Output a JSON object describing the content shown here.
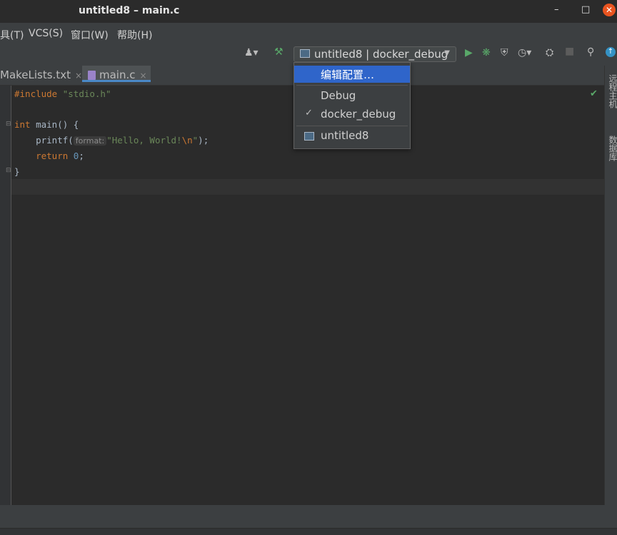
{
  "window": {
    "title": "untitled8 – main.c",
    "min": "–",
    "max": "□",
    "close": "✕"
  },
  "menu": [
    {
      "label": "具(T)"
    },
    {
      "label": "VCS(S)"
    },
    {
      "label": "窗口(W)"
    },
    {
      "label": "帮助(H)"
    }
  ],
  "run_config": {
    "label": "untitled8 | docker_debug",
    "arrow": "▼"
  },
  "tabs": [
    {
      "label": "MakeLists.txt",
      "close": "×"
    },
    {
      "label": "main.c",
      "close": "×"
    }
  ],
  "code": {
    "line1": {
      "kw": "#include",
      "str": "\"stdio.h\""
    },
    "line3": {
      "kw": "int",
      "rest": " main() {"
    },
    "line4": {
      "pre": "    printf(",
      "hint": "format:",
      "str1": "\"Hello, World!",
      "esc": "\\n",
      "str2": "\"",
      "post": ");"
    },
    "line5": {
      "kw": "    return",
      "num": " 0",
      "post": ";"
    },
    "line6": {
      "text": "}"
    }
  },
  "dropdown": {
    "edit_config": "编辑配置…",
    "debug": "Debug",
    "docker_debug": "docker_debug",
    "docker_check": "✓",
    "untitled8": "untitled8"
  },
  "right_panel": {
    "remote_host": "远程主机",
    "database": "数据库"
  },
  "icons": {
    "person": "person-icon",
    "build": "hammer-icon",
    "run": "run-icon",
    "debug": "bug-icon",
    "coverage": "coverage-icon",
    "profile": "profile-icon",
    "attach": "attach-icon",
    "stop": "stop-icon",
    "search": "search-icon",
    "update": "update-icon"
  },
  "colors": {
    "accent": "#2f65ca",
    "run_green": "#59a869",
    "close_orange": "#e95420"
  }
}
